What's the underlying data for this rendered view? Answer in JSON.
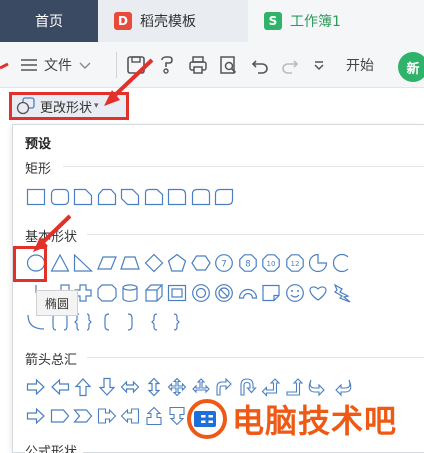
{
  "tabs": {
    "home": "首页",
    "template": "稻壳模板",
    "template_logo": "D",
    "workbook": "工作簿1",
    "workbook_logo": "S"
  },
  "toolbar": {
    "file_label": "文件",
    "start_label": "开始",
    "new_label": "新"
  },
  "change_shape": {
    "label": "更改形状"
  },
  "panel": {
    "title": "预设",
    "sections": {
      "rectangle": "矩形",
      "basic": "基本形状",
      "arrows": "箭头总汇",
      "formula": "公式形状"
    }
  },
  "tooltip": "椭圆",
  "watermark": "电脑技术吧",
  "colors": {
    "accent_red": "#e2302a",
    "shape_stroke": "#4a7fc1",
    "wps_green": "#2fb36a",
    "watermark_orange": "#ee5a15"
  }
}
